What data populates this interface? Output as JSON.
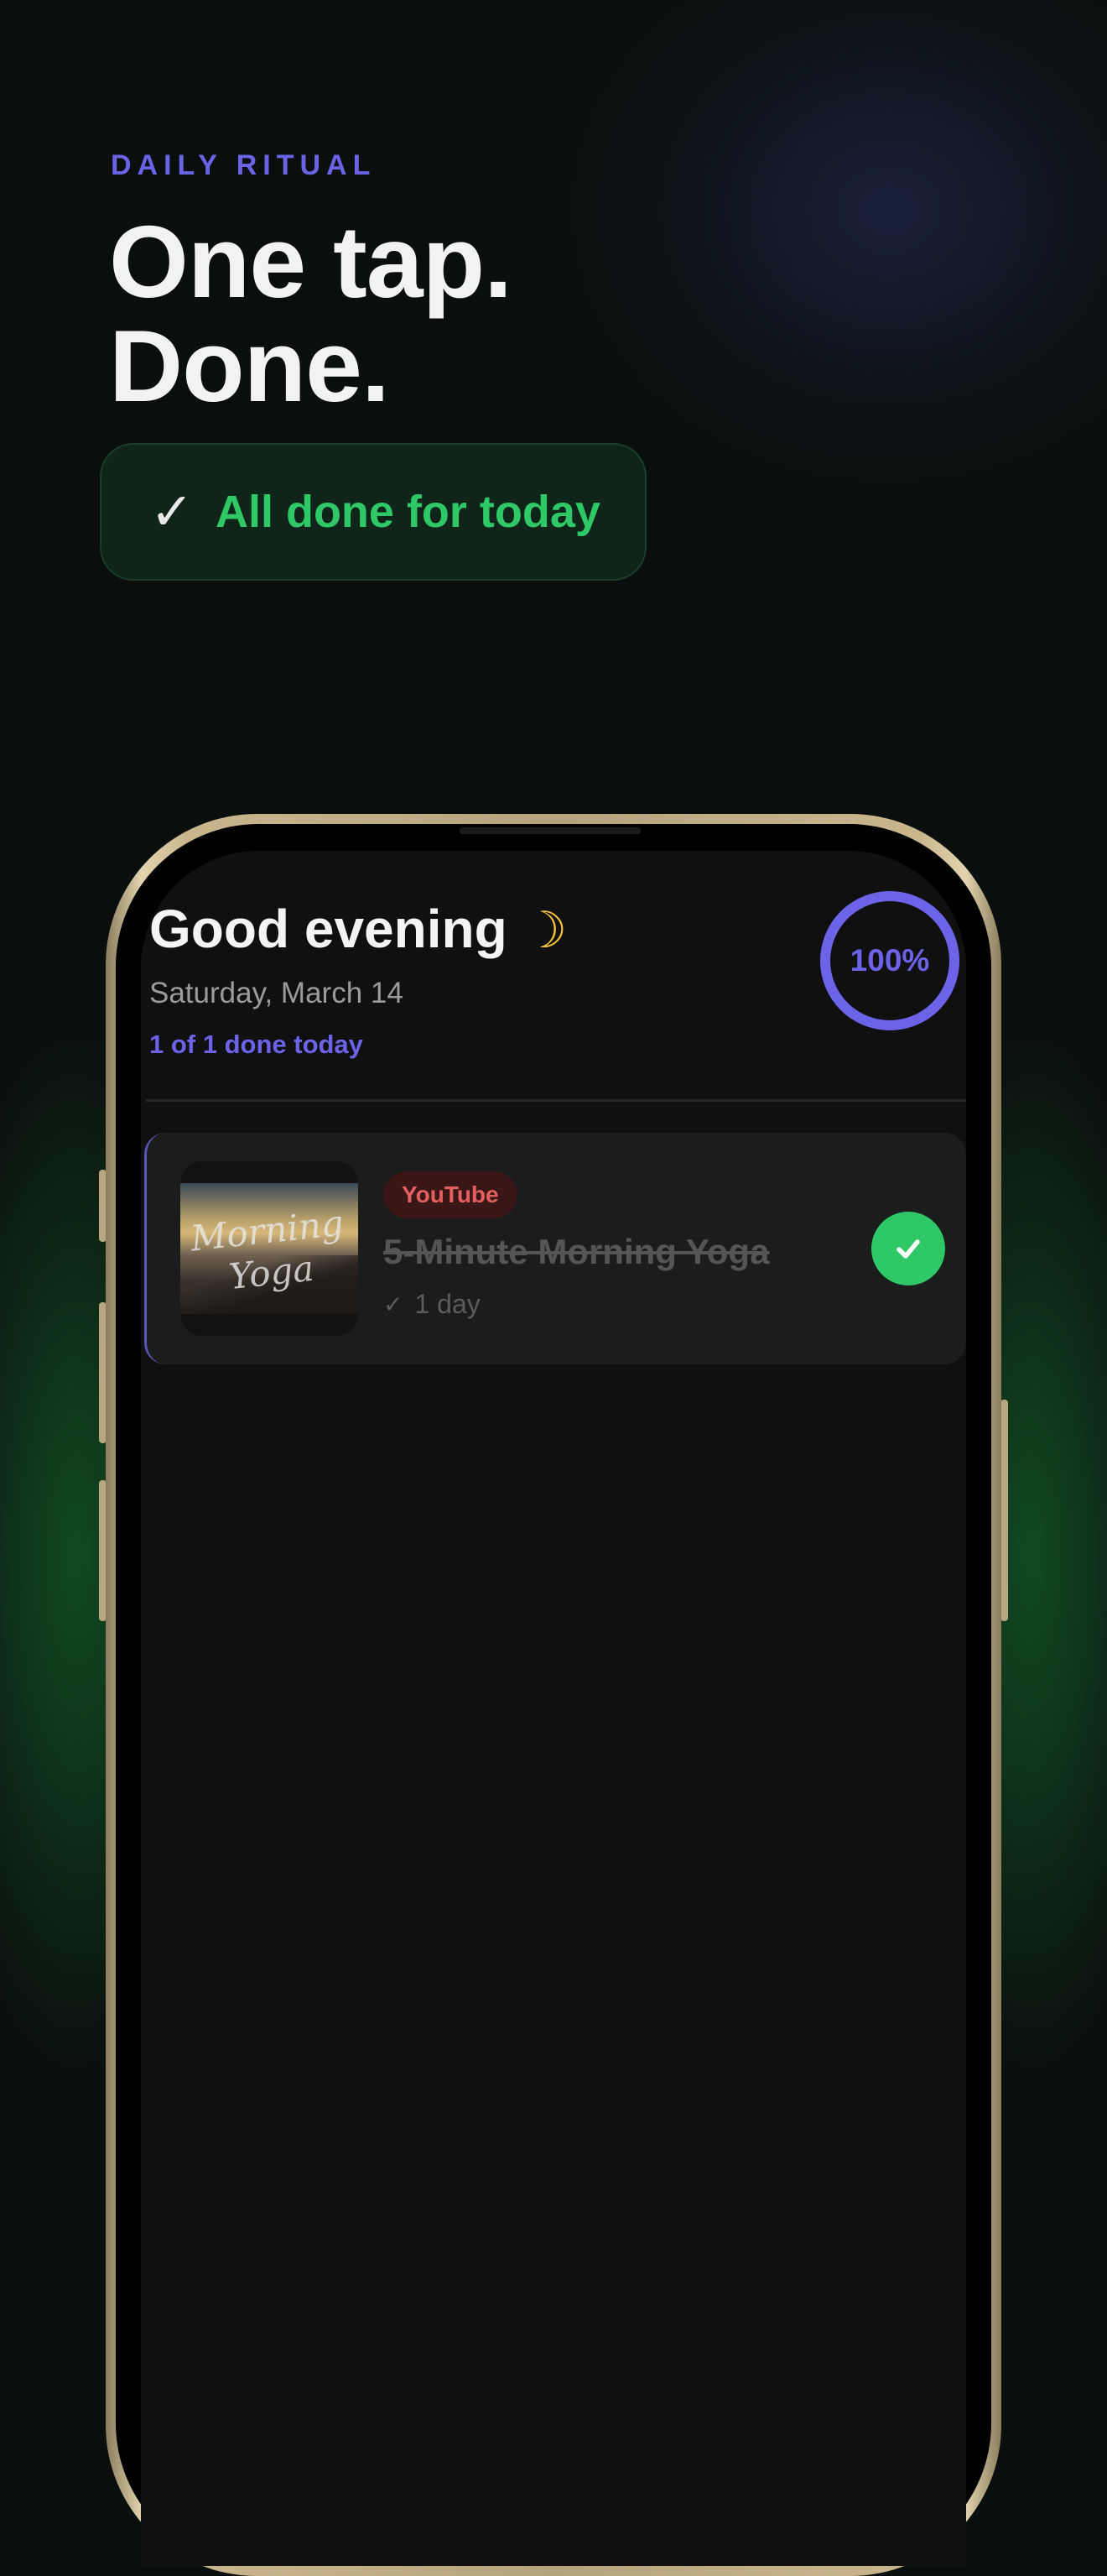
{
  "hero": {
    "eyebrow": "DAILY RITUAL",
    "title_line1": "One tap.",
    "title_line2": "Done.",
    "done_badge": {
      "icon": "check-icon",
      "label": "All done for today"
    }
  },
  "app": {
    "greeting": "Good evening",
    "greeting_icon": "moon-icon",
    "date": "Saturday, March 14",
    "progress_text": "1 of 1 done today",
    "progress_ring": {
      "percent": 100,
      "label": "100%"
    },
    "tasks": [
      {
        "source": "YouTube",
        "title": "5-Minute Morning Yoga",
        "thumbnail_text": "Morning Yoga",
        "streak": "1 day",
        "completed": true
      }
    ]
  },
  "colors": {
    "accent": "#6c63e8",
    "success": "#2fc866",
    "youtube": "#e46060",
    "background": "#0a0f0d"
  }
}
